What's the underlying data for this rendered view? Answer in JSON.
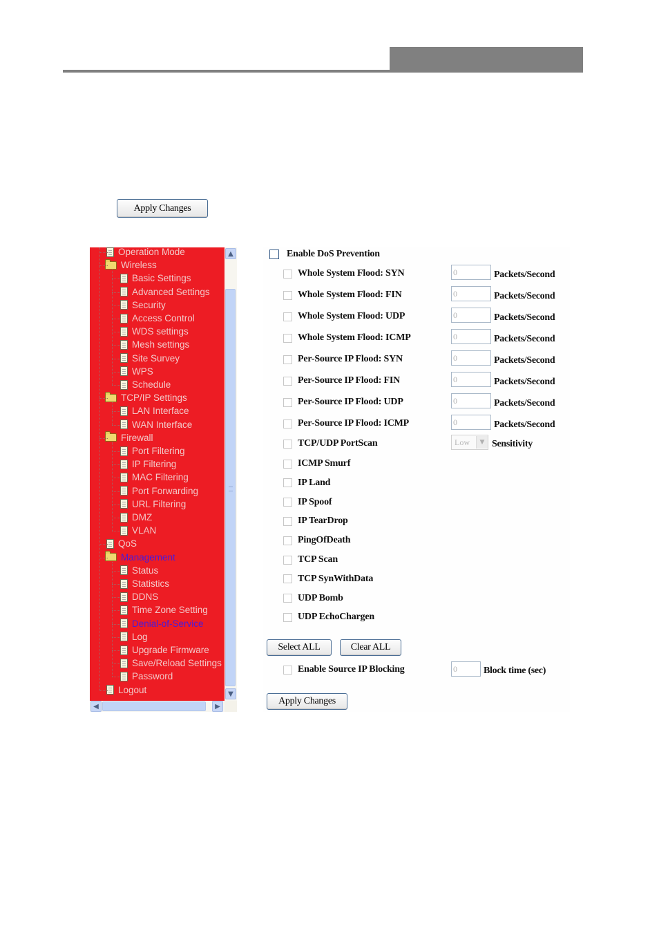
{
  "top_apply_label": "Apply Changes",
  "sidebar": {
    "items": [
      {
        "label": "Operation Mode",
        "type": "doc",
        "level": 0
      },
      {
        "label": "Wireless",
        "type": "folder",
        "level": 0
      },
      {
        "label": "Basic Settings",
        "type": "doc",
        "level": 1
      },
      {
        "label": "Advanced Settings",
        "type": "doc",
        "level": 1
      },
      {
        "label": "Security",
        "type": "doc",
        "level": 1
      },
      {
        "label": "Access Control",
        "type": "doc",
        "level": 1
      },
      {
        "label": "WDS settings",
        "type": "doc",
        "level": 1
      },
      {
        "label": "Mesh settings",
        "type": "doc",
        "level": 1
      },
      {
        "label": "Site Survey",
        "type": "doc",
        "level": 1
      },
      {
        "label": "WPS",
        "type": "doc",
        "level": 1
      },
      {
        "label": "Schedule",
        "type": "doc",
        "level": 1
      },
      {
        "label": "TCP/IP Settings",
        "type": "folder",
        "level": 0
      },
      {
        "label": "LAN Interface",
        "type": "doc",
        "level": 1
      },
      {
        "label": "WAN Interface",
        "type": "doc",
        "level": 1
      },
      {
        "label": "Firewall",
        "type": "folder",
        "level": 0
      },
      {
        "label": "Port Filtering",
        "type": "doc",
        "level": 1
      },
      {
        "label": "IP Filtering",
        "type": "doc",
        "level": 1
      },
      {
        "label": "MAC Filtering",
        "type": "doc",
        "level": 1
      },
      {
        "label": "Port Forwarding",
        "type": "doc",
        "level": 1
      },
      {
        "label": "URL Filtering",
        "type": "doc",
        "level": 1
      },
      {
        "label": "DMZ",
        "type": "doc",
        "level": 1
      },
      {
        "label": "VLAN",
        "type": "doc",
        "level": 1
      },
      {
        "label": "QoS",
        "type": "doc",
        "level": 0
      },
      {
        "label": "Management",
        "type": "folder",
        "level": 0,
        "active": true
      },
      {
        "label": "Status",
        "type": "doc",
        "level": 1
      },
      {
        "label": "Statistics",
        "type": "doc",
        "level": 1
      },
      {
        "label": "DDNS",
        "type": "doc",
        "level": 1
      },
      {
        "label": "Time Zone Setting",
        "type": "doc",
        "level": 1
      },
      {
        "label": "Denial-of-Service",
        "type": "doc",
        "level": 1,
        "active": true
      },
      {
        "label": "Log",
        "type": "doc",
        "level": 1
      },
      {
        "label": "Upgrade Firmware",
        "type": "doc",
        "level": 1
      },
      {
        "label": "Save/Reload Settings",
        "type": "doc",
        "level": 1
      },
      {
        "label": "Password",
        "type": "doc",
        "level": 1
      },
      {
        "label": "Logout",
        "type": "doc",
        "level": 0
      }
    ],
    "colors": {
      "background": "#ed1c24",
      "text": "#f2c8c8",
      "active_text": "#4b1ad9"
    }
  },
  "dos": {
    "enable_label": "Enable DoS Prevention",
    "enable_checked": false,
    "rate_rows": [
      {
        "label": "Whole System Flood: SYN",
        "value": "0",
        "unit": "Packets/Second",
        "checked": false
      },
      {
        "label": "Whole System Flood: FIN",
        "value": "0",
        "unit": "Packets/Second",
        "checked": false
      },
      {
        "label": "Whole System Flood: UDP",
        "value": "0",
        "unit": "Packets/Second",
        "checked": false
      },
      {
        "label": "Whole System Flood: ICMP",
        "value": "0",
        "unit": "Packets/Second",
        "checked": false
      },
      {
        "label": "Per-Source IP Flood: SYN",
        "value": "0",
        "unit": "Packets/Second",
        "checked": false
      },
      {
        "label": "Per-Source IP Flood: FIN",
        "value": "0",
        "unit": "Packets/Second",
        "checked": false
      },
      {
        "label": "Per-Source IP Flood: UDP",
        "value": "0",
        "unit": "Packets/Second",
        "checked": false
      },
      {
        "label": "Per-Source IP Flood: ICMP",
        "value": "0",
        "unit": "Packets/Second",
        "checked": false
      }
    ],
    "portscan": {
      "label": "TCP/UDP PortScan",
      "sensitivity_value": "Low",
      "sensitivity_label": "Sensitivity",
      "checked": false
    },
    "simple_rows": [
      {
        "label": "ICMP Smurf",
        "checked": false
      },
      {
        "label": "IP Land",
        "checked": false
      },
      {
        "label": "IP Spoof",
        "checked": false
      },
      {
        "label": "IP TearDrop",
        "checked": false
      },
      {
        "label": "PingOfDeath",
        "checked": false
      },
      {
        "label": "TCP Scan",
        "checked": false
      },
      {
        "label": "TCP SynWithData",
        "checked": false
      },
      {
        "label": "UDP Bomb",
        "checked": false
      },
      {
        "label": "UDP EchoChargen",
        "checked": false
      }
    ],
    "select_all_label": "Select ALL",
    "clear_all_label": "Clear ALL",
    "source_block": {
      "label": "Enable Source IP Blocking",
      "value": "0",
      "unit": "Block time (sec)",
      "checked": false
    },
    "apply_label": "Apply Changes"
  }
}
